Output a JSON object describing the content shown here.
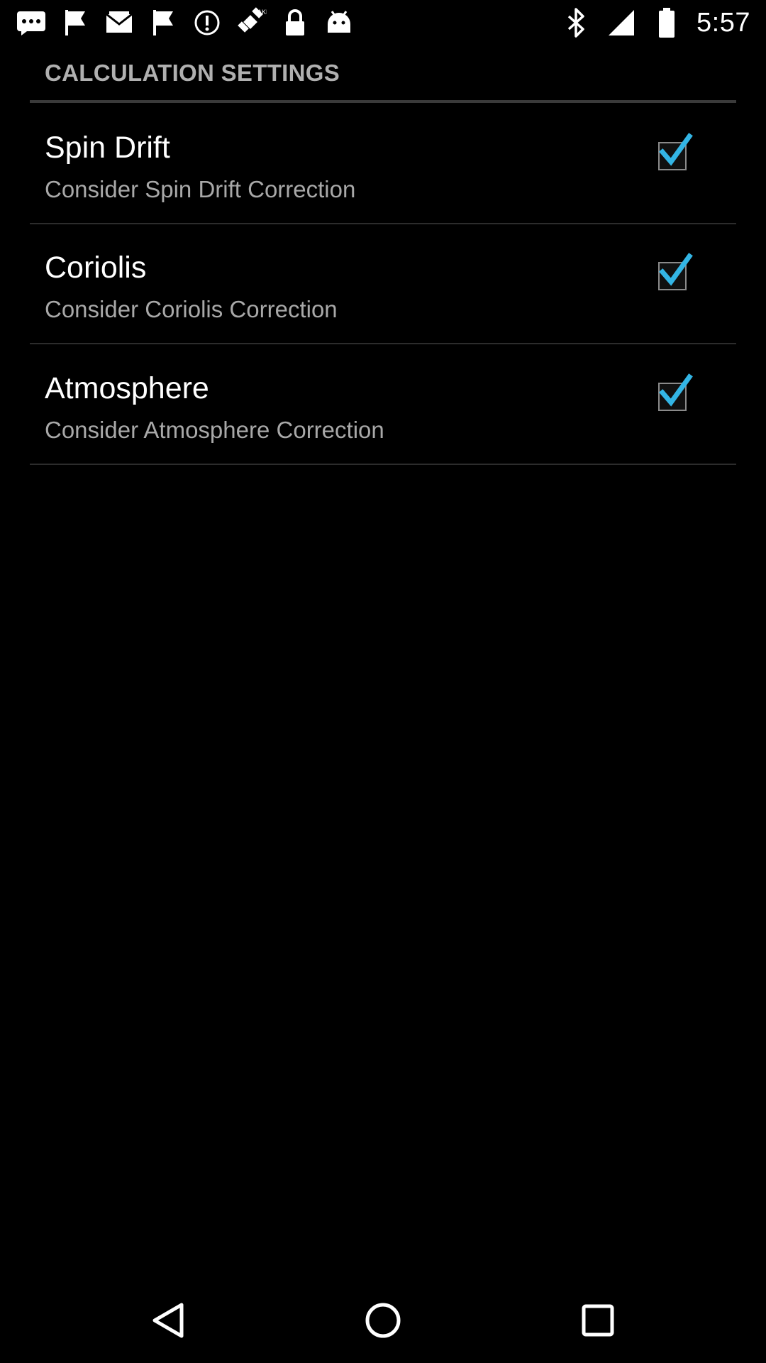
{
  "status_bar": {
    "time": "5:57",
    "left_icons": [
      "messages-icon",
      "flag-icon",
      "email-icon",
      "flag-icon",
      "data-saver-icon",
      "fake-gps-icon",
      "lock-icon",
      "android-icon"
    ],
    "right_icons": [
      "bluetooth-icon",
      "signal-icon",
      "battery-icon"
    ]
  },
  "settings": {
    "section_title": "CALCULATION SETTINGS",
    "items": [
      {
        "title": "Spin Drift",
        "summary": "Consider Spin Drift Correction",
        "checked": true
      },
      {
        "title": "Coriolis",
        "summary": "Consider Coriolis Correction",
        "checked": true
      },
      {
        "title": "Atmosphere",
        "summary": "Consider Atmosphere Correction",
        "checked": true
      }
    ]
  },
  "nav_bar": {
    "buttons": [
      "back-icon",
      "home-icon",
      "recents-icon"
    ]
  },
  "colors": {
    "background": "#000000",
    "accent": "#33b5e5",
    "title_text": "#ffffff",
    "summary_text": "#a8a8a8",
    "header_text": "#b0b0b0"
  }
}
